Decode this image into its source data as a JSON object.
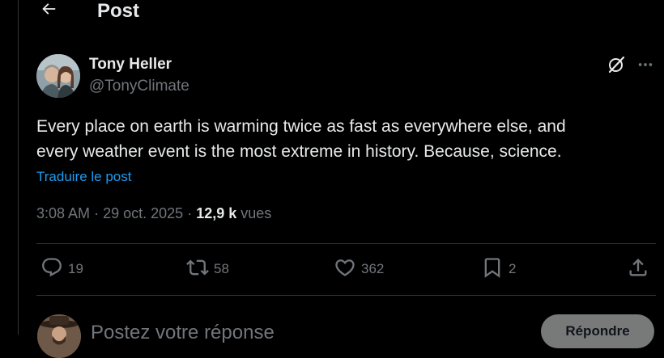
{
  "header": {
    "back_icon": "arrow-left-icon",
    "title": "Post"
  },
  "author": {
    "name": "Tony Heller",
    "handle": "@TonyClimate"
  },
  "tweet": {
    "lines": [
      "Every place on earth is warming twice as fast as everywhere else, and",
      "every weather event is the most extreme in history.  Because, science."
    ],
    "translate_label": "Traduire le post",
    "time": "3:08 AM",
    "date": "29 oct. 2025",
    "separator": "·",
    "views_count": "12,9 k",
    "views_label": "vues"
  },
  "actions": {
    "replies": {
      "icon": "reply-icon",
      "count": "19"
    },
    "reposts": {
      "icon": "repost-icon",
      "count": "58"
    },
    "likes": {
      "icon": "heart-icon",
      "count": "362"
    },
    "bookmarks": {
      "icon": "bookmark-icon",
      "count": "2"
    },
    "share": {
      "icon": "share-icon"
    }
  },
  "reply_box": {
    "placeholder": "Postez votre réponse",
    "button_label": "Répondre"
  },
  "colors": {
    "background": "#000000",
    "text_primary": "#e7e9ea",
    "text_secondary": "#71767b",
    "link": "#1d9bf0",
    "divider": "#2f3336",
    "reply_button_disabled": "#787a7a"
  }
}
